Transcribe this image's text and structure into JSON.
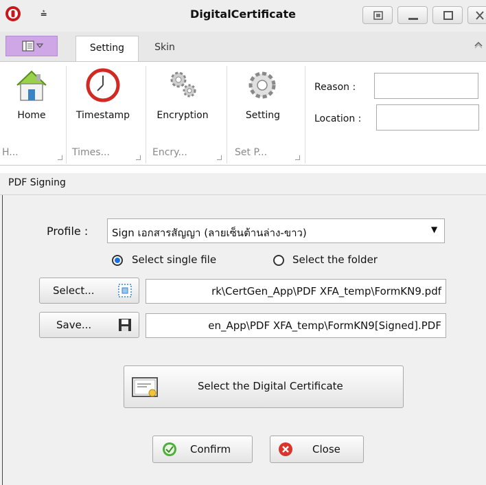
{
  "window": {
    "title": "DigitalCertificate"
  },
  "tabs": {
    "setting": "Setting",
    "skin": "Skin"
  },
  "ribbon": {
    "buttons": [
      {
        "label": "Home",
        "icon": "home-icon"
      },
      {
        "label": "Timestamp",
        "icon": "clock-icon"
      },
      {
        "label": "Encryption",
        "icon": "gears-icon"
      },
      {
        "label": "Setting",
        "icon": "gear-icon"
      }
    ],
    "groups": [
      "H...",
      "Times...",
      "Encry...",
      "Set P..."
    ],
    "reason_label": "Reason :",
    "reason_value": "",
    "location_label": "Location :",
    "location_value": ""
  },
  "section": {
    "title": "PDF Signing"
  },
  "form": {
    "profile_label": "Profile :",
    "profile_value": "Sign เอกสารสัญญา (ลายเซ็นต้านล่าง-ขาว)",
    "radio_single": "Select single file",
    "radio_folder": "Select the folder",
    "radio_selected": "single",
    "select_button": "Select...",
    "select_path": "rk\\CertGen_App\\PDF XFA_temp\\FormKN9.pdf",
    "save_button": "Save...",
    "save_path": "en_App\\PDF XFA_temp\\FormKN9[Signed].PDF",
    "cert_button": "Select the Digital Certificate",
    "confirm_button": "Confirm",
    "close_button": "Close"
  },
  "colors": {
    "accent_purple": "#cfa7e6",
    "radio_blue": "#1a6fe0",
    "confirm_green": "#4caf3c",
    "close_red": "#d9352b"
  }
}
